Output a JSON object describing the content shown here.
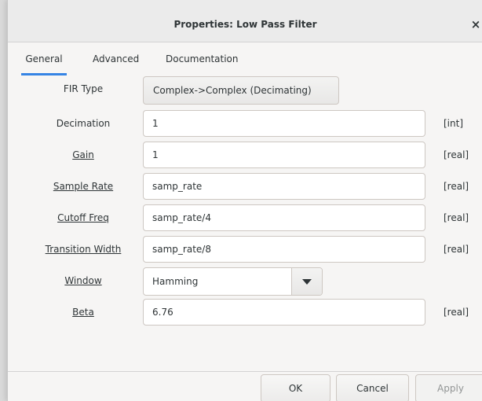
{
  "dialog": {
    "title": "Properties: Low Pass Filter",
    "close_label": "×"
  },
  "tabs": [
    {
      "label": "General",
      "active": true
    },
    {
      "label": "Advanced",
      "active": false
    },
    {
      "label": "Documentation",
      "active": false
    }
  ],
  "fields": {
    "fir_type": {
      "label": "FIR Type",
      "value": "Complex->Complex (Decimating)"
    },
    "decimation": {
      "label": "Decimation",
      "value": "1",
      "unit": "[int]"
    },
    "gain": {
      "label": "Gain",
      "value": "1",
      "unit": "[real]"
    },
    "sample_rate": {
      "label": "Sample Rate",
      "value": "samp_rate",
      "unit": "[real]"
    },
    "cutoff_freq": {
      "label": "Cutoff Freq",
      "value": "samp_rate/4",
      "unit": "[real]"
    },
    "transition_width": {
      "label": "Transition Width",
      "value": "samp_rate/8",
      "unit": "[real]"
    },
    "window": {
      "label": "Window",
      "value": "Hamming"
    },
    "beta": {
      "label": "Beta",
      "value": "6.76",
      "unit": "[real]"
    }
  },
  "buttons": {
    "ok": "OK",
    "cancel": "Cancel",
    "apply": "Apply"
  },
  "colors": {
    "accent": "#3584e4",
    "background": "#f6f5f4",
    "titlebar": "#ebebeb"
  }
}
